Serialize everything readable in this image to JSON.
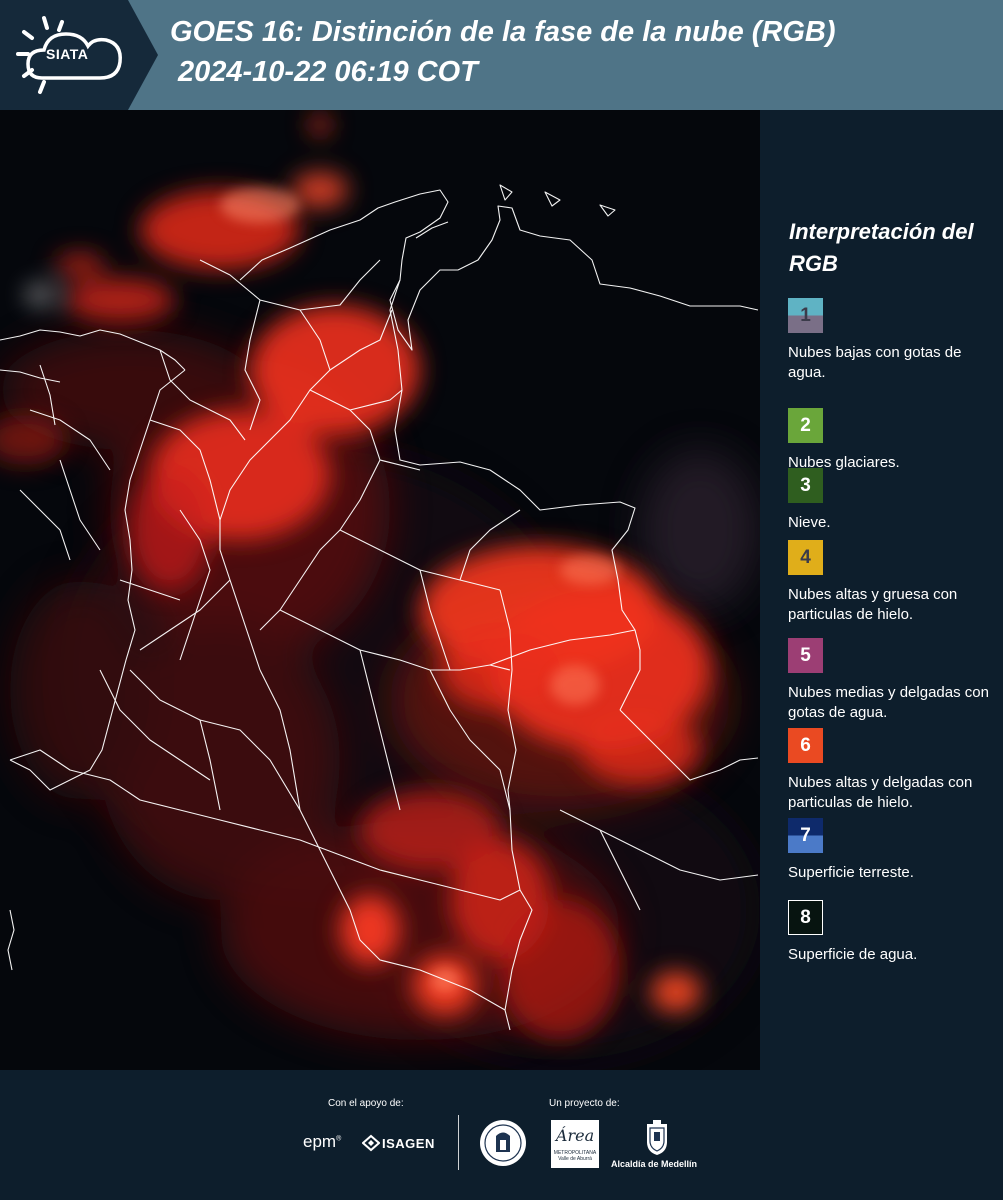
{
  "header": {
    "logo_text": "SIATA",
    "title_line1": "GOES 16: Distinción de la fase de la nube (RGB)",
    "title_line2": "2024-10-22 06:19 COT"
  },
  "legend": {
    "title": "Interpretación del RGB",
    "items": [
      {
        "number": "1",
        "label": "Nubes bajas con gotas de agua.",
        "color_top": "#5fb3c4",
        "color_bottom": "#7a6f87",
        "text_color": "#3b3b4a"
      },
      {
        "number": "2",
        "label": "Nubes glaciares.",
        "color_top": "#6aa63a",
        "color_bottom": "#6aa63a",
        "text_color": "#ffffff"
      },
      {
        "number": "3",
        "label": "Nieve.",
        "color_top": "#2f5e1f",
        "color_bottom": "#2f5e1f",
        "text_color": "#ffffff"
      },
      {
        "number": "4",
        "label": "Nubes altas y gruesa con particulas de hielo.",
        "color_top": "#e0ae1a",
        "color_bottom": "#e0ae1a",
        "text_color": "#3b3b4a"
      },
      {
        "number": "5",
        "label": "Nubes medias y delgadas con gotas de agua.",
        "color_top": "#9c3e74",
        "color_bottom": "#9c3e74",
        "text_color": "#ffffff"
      },
      {
        "number": "6",
        "label": "Nubes altas y delgadas con particulas de hielo.",
        "color_top": "#ea4a22",
        "color_bottom": "#ea4a22",
        "text_color": "#ffffff"
      },
      {
        "number": "7",
        "label": "Superficie terreste.",
        "color_top": "#0e2a6b",
        "color_bottom": "#4b7ac8",
        "text_color": "#ffffff"
      },
      {
        "number": "8",
        "label": "Superficie de agua.",
        "color_top": "#071410",
        "color_bottom": "#071410",
        "text_color": "#ffffff",
        "border": "#ffffff"
      }
    ]
  },
  "footer": {
    "support_label": "Con el apoyo de:",
    "project_label": "Un proyecto de:",
    "epm": "epm",
    "isagen": "ISAGEN",
    "area_name": "Área",
    "area_sub": "METROPOLITANA Valle de Aburrá",
    "alcaldia": "Alcaldía de Medellín"
  }
}
